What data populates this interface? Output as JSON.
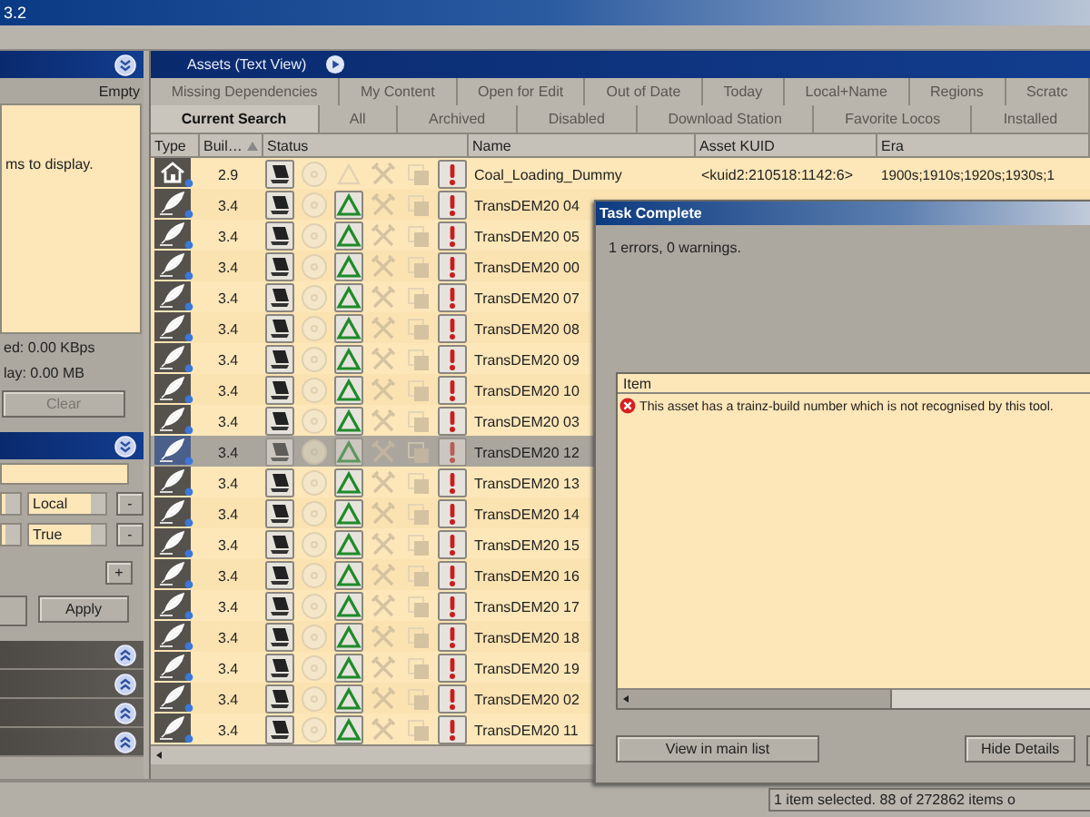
{
  "window": {
    "title": "3.2"
  },
  "left_panel": {
    "results_header": {
      "expanded": true
    },
    "status": "Empty",
    "list_message": "ms to display.",
    "download_speed": "ed: 0.00 KBps",
    "download_size": "lay: 0.00 MB",
    "clear_button": {
      "label": "Clear",
      "disabled": true
    },
    "filter_header": {
      "expanded": true
    },
    "filters": [
      {
        "value": "Local",
        "remove_label": "-"
      },
      {
        "value": "True",
        "remove_label": "-"
      }
    ],
    "add_button": "+",
    "apply_button": "Apply",
    "collapsed_sections": [
      {
        "expanded": false
      },
      {
        "expanded": false
      },
      {
        "expanded": false
      },
      {
        "expanded": false
      }
    ]
  },
  "assets_panel": {
    "title": "Assets (Text View)",
    "tabs_row_1": [
      {
        "label": "Missing Dependencies",
        "selected": false
      },
      {
        "label": "My Content",
        "selected": false
      },
      {
        "label": "Open for Edit",
        "selected": false
      },
      {
        "label": "Out of Date",
        "selected": false
      },
      {
        "label": "Today",
        "selected": false
      },
      {
        "label": "Local+Name",
        "selected": false
      },
      {
        "label": "Regions",
        "selected": false
      },
      {
        "label": "Scratc",
        "selected": false
      }
    ],
    "tabs_row_2": [
      {
        "label": "Current Search",
        "selected": true
      },
      {
        "label": "All",
        "selected": false
      },
      {
        "label": "Archived",
        "selected": false
      },
      {
        "label": "Disabled",
        "selected": false
      },
      {
        "label": "Download Station",
        "selected": false
      },
      {
        "label": "Favorite Locos",
        "selected": false
      },
      {
        "label": "Installed",
        "selected": false
      }
    ],
    "columns": [
      {
        "label": "Type",
        "sorted": false
      },
      {
        "label": "Buil…",
        "sorted": true
      },
      {
        "label": "Status",
        "sorted": false
      },
      {
        "label": "Name",
        "sorted": false
      },
      {
        "label": "Asset KUID",
        "sorted": false
      },
      {
        "label": "Era",
        "sorted": false
      }
    ],
    "rows": [
      {
        "kind": "house",
        "build": "2.9",
        "name": "Coal_Loading_Dummy",
        "kuid": "<kuid2:210518:1142:6>",
        "era": "1900s;1910s;1920s;1930s;1",
        "triangle_active": false,
        "selected": false
      },
      {
        "kind": "feather",
        "build": "3.4",
        "name": "TransDEM20 04",
        "triangle_active": true,
        "selected": false
      },
      {
        "kind": "feather",
        "build": "3.4",
        "name": "TransDEM20 05",
        "triangle_active": true,
        "selected": false
      },
      {
        "kind": "feather",
        "build": "3.4",
        "name": "TransDEM20 00",
        "triangle_active": true,
        "selected": false
      },
      {
        "kind": "feather",
        "build": "3.4",
        "name": "TransDEM20 07",
        "triangle_active": true,
        "selected": false
      },
      {
        "kind": "feather",
        "build": "3.4",
        "name": "TransDEM20 08",
        "triangle_active": true,
        "selected": false
      },
      {
        "kind": "feather",
        "build": "3.4",
        "name": "TransDEM20 09",
        "triangle_active": true,
        "selected": false
      },
      {
        "kind": "feather",
        "build": "3.4",
        "name": "TransDEM20 10",
        "triangle_active": true,
        "selected": false
      },
      {
        "kind": "feather",
        "build": "3.4",
        "name": "TransDEM20 03",
        "triangle_active": true,
        "selected": false
      },
      {
        "kind": "feather",
        "build": "3.4",
        "name": "TransDEM20 12",
        "triangle_active": true,
        "selected": true
      },
      {
        "kind": "feather",
        "build": "3.4",
        "name": "TransDEM20 13",
        "triangle_active": true,
        "selected": false
      },
      {
        "kind": "feather",
        "build": "3.4",
        "name": "TransDEM20 14",
        "triangle_active": true,
        "selected": false
      },
      {
        "kind": "feather",
        "build": "3.4",
        "name": "TransDEM20 15",
        "triangle_active": true,
        "selected": false
      },
      {
        "kind": "feather",
        "build": "3.4",
        "name": "TransDEM20 16",
        "triangle_active": true,
        "selected": false
      },
      {
        "kind": "feather",
        "build": "3.4",
        "name": "TransDEM20 17",
        "triangle_active": true,
        "selected": false
      },
      {
        "kind": "feather",
        "build": "3.4",
        "name": "TransDEM20 18",
        "triangle_active": true,
        "selected": false
      },
      {
        "kind": "feather",
        "build": "3.4",
        "name": "TransDEM20 19",
        "triangle_active": true,
        "selected": false
      },
      {
        "kind": "feather",
        "build": "3.4",
        "name": "TransDEM20 02",
        "triangle_active": true,
        "selected": false
      },
      {
        "kind": "feather",
        "build": "3.4",
        "name": "TransDEM20 11",
        "triangle_active": true,
        "selected": false
      }
    ]
  },
  "dialog": {
    "title": "Task Complete",
    "summary": "1 errors, 0 warnings.",
    "list_header": "Item",
    "messages": [
      {
        "kind": "error",
        "text": "This asset has a trainz-build number which is not recognised by this tool."
      }
    ],
    "buttons": [
      "View in main list",
      "Hide Details"
    ]
  },
  "status_bar": {
    "text": "1 item selected. 88 of 272862 items o"
  }
}
